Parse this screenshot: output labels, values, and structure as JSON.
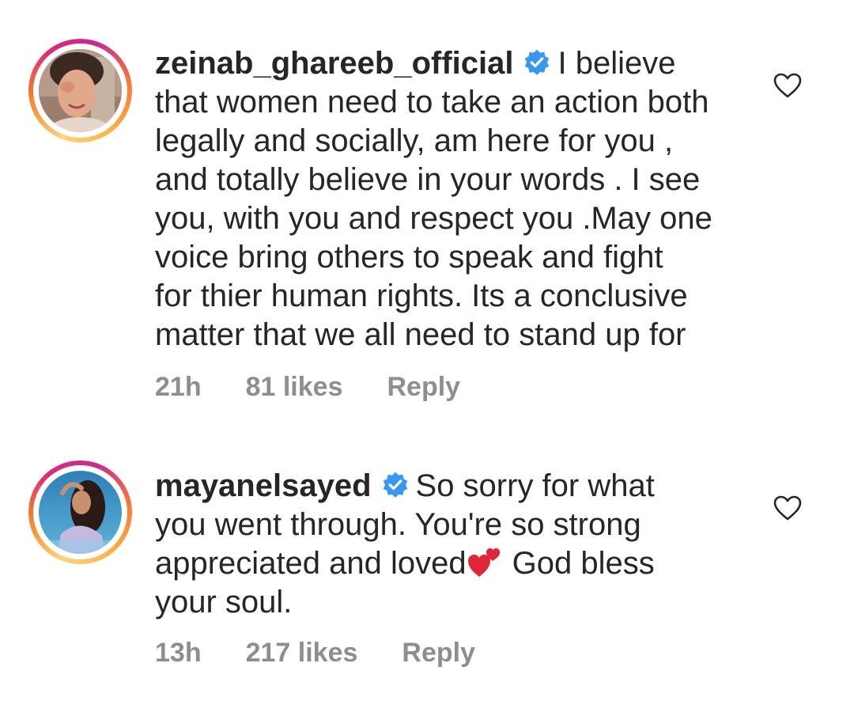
{
  "comments": [
    {
      "username": "zeinab_ghareeb_official",
      "verified": true,
      "text_lines": [
        "I believe",
        "that women need to take an action both",
        "legally and socially, am here for you ,",
        "and totally believe in your words .  I see",
        "you, with you and respect you .May one",
        "voice bring others to speak and fight",
        "for thier human rights.  Its a conclusive",
        "matter that we all need to stand up for"
      ],
      "time": "21h",
      "likes": "81 likes",
      "reply_label": "Reply",
      "icons": {
        "avatar": "avatar",
        "verified": "verified-badge-icon",
        "like": "heart-outline-icon"
      }
    },
    {
      "username": "mayanelsayed",
      "verified": true,
      "text_lines": [
        "So sorry for what",
        "you went through. You're so strong",
        "appreciated and loved",
        "God bless",
        "your soul."
      ],
      "emoji": "two-hearts-emoji",
      "time": "13h",
      "likes": "217 likes",
      "reply_label": "Reply",
      "icons": {
        "avatar": "avatar",
        "verified": "verified-badge-icon",
        "like": "heart-outline-icon"
      }
    }
  ],
  "colors": {
    "text": "#262626",
    "meta": "#8e8e8e",
    "verified_blue": "#3897f0",
    "emoji_red": "#e0263b"
  }
}
